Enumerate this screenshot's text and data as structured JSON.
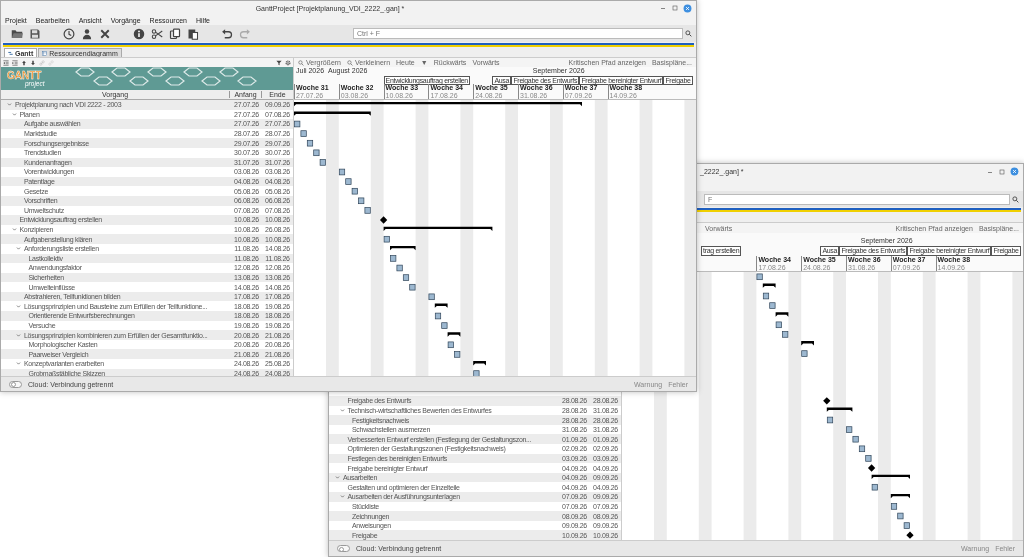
{
  "windows": [
    {
      "title": "GanttProject [Projektplanung_VDI_2222_.gan] *",
      "menu": [
        "Projekt",
        "Bearbeiten",
        "Ansicht",
        "Vorgänge",
        "Ressourcen",
        "Hilfe"
      ],
      "search": {
        "placeholder": "Ctrl + F"
      },
      "tabs": [
        {
          "label": "Gantt",
          "selected": true
        },
        {
          "label": "Ressourcendiagramm",
          "selected": false
        }
      ],
      "logo": {
        "title": "GANTT",
        "subtitle": "project"
      },
      "columns": [
        "Vorgang",
        "Anfang",
        "Ende"
      ],
      "chart_toolbar": {
        "left": [
          {
            "label": "Vergrößern",
            "kind": "zoom"
          },
          {
            "label": "Verkleinern",
            "kind": "zoom"
          },
          {
            "label": "Heute",
            "kind": "button"
          },
          {
            "label": "▼",
            "kind": "button"
          },
          {
            "label": "Rückwärts",
            "kind": "button"
          },
          {
            "label": "Vorwärts",
            "kind": "button"
          }
        ],
        "right": [
          "Kritischen Pfad anzeigen",
          "Basispläne..."
        ]
      },
      "months": [
        "Juli 2026",
        "August 2026",
        "September 2026"
      ],
      "milestone_labels": [
        "Entwicklungsauftrag erstellen",
        "Ausa",
        "Freigabe des Entwurfs",
        "Freigabe bereinigter Entwurf",
        "Freigabe"
      ],
      "weeks": [
        {
          "label": "Woche 31",
          "date": "27.07.26"
        },
        {
          "label": "Woche 32",
          "date": "03.08.26"
        },
        {
          "label": "Woche 33",
          "date": "10.08.26"
        },
        {
          "label": "Woche 34",
          "date": "17.08.26"
        },
        {
          "label": "Woche 35",
          "date": "24.08.26"
        },
        {
          "label": "Woche 36",
          "date": "31.08.26"
        },
        {
          "label": "Woche 37",
          "date": "07.09.26"
        },
        {
          "label": "Woche 38",
          "date": "14.09.26"
        }
      ],
      "tasks": [
        {
          "name": "Projektplanung nach VDI 2222 - 2003",
          "start": "27.07.26",
          "end": "09.09.26",
          "kind": "summary",
          "expanded": true,
          "children": [
            {
              "name": "Planen",
              "start": "27.07.26",
              "end": "07.08.26",
              "kind": "summary",
              "expanded": true,
              "children": [
                {
                  "name": "Aufgabe auswählen",
                  "start": "27.07.26",
                  "end": "27.07.26",
                  "kind": "task"
                },
                {
                  "name": "Marktstudie",
                  "start": "28.07.26",
                  "end": "28.07.26",
                  "kind": "task"
                },
                {
                  "name": "Forschungsergebnisse",
                  "start": "29.07.26",
                  "end": "29.07.26",
                  "kind": "task"
                },
                {
                  "name": "Trendstudien",
                  "start": "30.07.26",
                  "end": "30.07.26",
                  "kind": "task"
                },
                {
                  "name": "Kundenanfragen",
                  "start": "31.07.26",
                  "end": "31.07.26",
                  "kind": "task"
                },
                {
                  "name": "Vorentwicklungen",
                  "start": "03.08.26",
                  "end": "03.08.26",
                  "kind": "task"
                },
                {
                  "name": "Patentlage",
                  "start": "04.08.26",
                  "end": "04.08.26",
                  "kind": "task"
                },
                {
                  "name": "Gesetze",
                  "start": "05.08.26",
                  "end": "05.08.26",
                  "kind": "task"
                },
                {
                  "name": "Vorschriften",
                  "start": "06.08.26",
                  "end": "06.08.26",
                  "kind": "task"
                },
                {
                  "name": "Umweltschutz",
                  "start": "07.08.26",
                  "end": "07.08.26",
                  "kind": "task"
                }
              ]
            },
            {
              "name": "Entwicklungsauftrag erstellen",
              "start": "10.08.26",
              "end": "10.08.26",
              "kind": "milestone"
            },
            {
              "name": "Konzipieren",
              "start": "10.08.26",
              "end": "26.08.26",
              "kind": "summary",
              "expanded": true,
              "children": [
                {
                  "name": "Aufgabenstellung klären",
                  "start": "10.08.26",
                  "end": "10.08.26",
                  "kind": "task"
                },
                {
                  "name": "Anforderungsliste erstellen",
                  "start": "11.08.26",
                  "end": "14.08.26",
                  "kind": "summary",
                  "expanded": true,
                  "children": [
                    {
                      "name": "Lastkollektiv",
                      "start": "11.08.26",
                      "end": "11.08.26",
                      "kind": "task"
                    },
                    {
                      "name": "Anwendungsfaktor",
                      "start": "12.08.26",
                      "end": "12.08.26",
                      "kind": "task"
                    },
                    {
                      "name": "Sicherheiten",
                      "start": "13.08.26",
                      "end": "13.08.26",
                      "kind": "task"
                    },
                    {
                      "name": "Umwelteinflüsse",
                      "start": "14.08.26",
                      "end": "14.08.26",
                      "kind": "task"
                    }
                  ]
                },
                {
                  "name": "Abstrahieren, Teilfunktionen bilden",
                  "start": "17.08.26",
                  "end": "17.08.26",
                  "kind": "task"
                },
                {
                  "name": "Lösungsprinzipien und Bausteine zum Erfüllen der Teilfunktione...",
                  "start": "18.08.26",
                  "end": "19.08.26",
                  "kind": "summary",
                  "expanded": true,
                  "children": [
                    {
                      "name": "Orientierende Entwurfsberechnungen",
                      "start": "18.08.26",
                      "end": "18.08.26",
                      "kind": "task"
                    },
                    {
                      "name": "Versuche",
                      "start": "19.08.26",
                      "end": "19.08.26",
                      "kind": "task"
                    }
                  ]
                },
                {
                  "name": "Lösungsprinzipien kombinieren zum Erfüllen der Gesamtfunktio...",
                  "start": "20.08.26",
                  "end": "21.08.26",
                  "kind": "summary",
                  "expanded": true,
                  "children": [
                    {
                      "name": "Morphologischer Kasten",
                      "start": "20.08.26",
                      "end": "20.08.26",
                      "kind": "task"
                    },
                    {
                      "name": "Paarweiser Vergleich",
                      "start": "21.08.26",
                      "end": "21.08.26",
                      "kind": "task"
                    }
                  ]
                },
                {
                  "name": "Konzeptvarianten erarbeiten",
                  "start": "24.08.26",
                  "end": "25.08.26",
                  "kind": "summary",
                  "expanded": true,
                  "children": [
                    {
                      "name": "Grobmaßstäbliche Skizzen",
                      "start": "24.08.26",
                      "end": "24.08.26",
                      "kind": "task"
                    }
                  ]
                }
              ]
            }
          ]
        }
      ],
      "status": {
        "cloud": {
          "on": false
        },
        "text": "Cloud: Verbindung getrennt",
        "notices": [
          "Warnung",
          "Fehler"
        ]
      }
    },
    {
      "title": "_2222_.gan] *",
      "search": {
        "placeholder": "F"
      },
      "chart_toolbar": {
        "left": [
          {
            "label": "Vorwärts",
            "kind": "button"
          }
        ],
        "right": [
          "Kritischen Pfad anzeigen",
          "Basispläne..."
        ]
      },
      "months": [
        "September 2026"
      ],
      "milestone_labels": [
        "trag erstellen",
        "Ausa",
        "Freigabe des Entwurfs",
        "Freigabe bereinigter Entwurf",
        "Freigabe"
      ],
      "weeks": [
        {
          "label": "Woche 34",
          "date": "17.08.26"
        },
        {
          "label": "Woche 35",
          "date": "24.08.26"
        },
        {
          "label": "Woche 36",
          "date": "31.08.26"
        },
        {
          "label": "Woche 37",
          "date": "07.09.26"
        },
        {
          "label": "Woche 38",
          "date": "14.09.26"
        }
      ],
      "tasks": [
        {
          "kind": "hidden",
          "children": [
            {
              "name": "Freigabe des Entwurfs",
              "start": "28.08.26",
              "end": "28.08.26",
              "kind": "milestone"
            },
            {
              "name": "Technisch-wirtschaftliches Bewerten des Entwurfes",
              "start": "28.08.26",
              "end": "31.08.26",
              "kind": "summary",
              "expanded": true,
              "children": [
                {
                  "name": "Festigkeitsnachweis",
                  "start": "28.08.26",
                  "end": "28.08.26",
                  "kind": "task"
                },
                {
                  "name": "Schwachstellen ausmerzen",
                  "start": "31.08.26",
                  "end": "31.08.26",
                  "kind": "task"
                }
              ]
            },
            {
              "name": "Verbesserten Entwurf erstellen (Festlegung der Gestaltungszon...",
              "start": "01.09.26",
              "end": "01.09.26",
              "kind": "task"
            },
            {
              "name": "Optimieren der Gestaltungszonen (Festigkeitsnachweis)",
              "start": "02.09.26",
              "end": "02.09.26",
              "kind": "task"
            },
            {
              "name": "Festlegen des bereinigten Entwurfs",
              "start": "03.09.26",
              "end": "03.09.26",
              "kind": "task"
            },
            {
              "name": "Freigabe bereinigter Entwurf",
              "start": "04.09.26",
              "end": "04.09.26",
              "kind": "milestone"
            }
          ]
        },
        {
          "name": "Ausarbeiten",
          "start": "04.09.26",
          "end": "09.09.26",
          "kind": "summary",
          "expanded": true,
          "children": [
            {
              "name": "Gestalten und optimieren der Einzelteile",
              "start": "04.09.26",
              "end": "04.09.26",
              "kind": "task"
            },
            {
              "name": "Ausarbeiten der Ausführungsunterlagen",
              "start": "07.09.26",
              "end": "09.09.26",
              "kind": "summary",
              "expanded": true,
              "children": [
                {
                  "name": "Stückliste",
                  "start": "07.09.26",
                  "end": "07.09.26",
                  "kind": "task"
                },
                {
                  "name": "Zeichnungen",
                  "start": "08.09.26",
                  "end": "08.09.26",
                  "kind": "task"
                },
                {
                  "name": "Anweisungen",
                  "start": "09.09.26",
                  "end": "09.09.26",
                  "kind": "task"
                },
                {
                  "name": "Freigabe",
                  "start": "10.09.26",
                  "end": "10.09.26",
                  "kind": "milestone"
                }
              ]
            }
          ]
        }
      ],
      "status": {
        "cloud": {
          "on": false
        },
        "text": "Cloud: Verbindung getrennt",
        "notices": [
          "Warnung",
          "Fehler"
        ]
      }
    }
  ]
}
